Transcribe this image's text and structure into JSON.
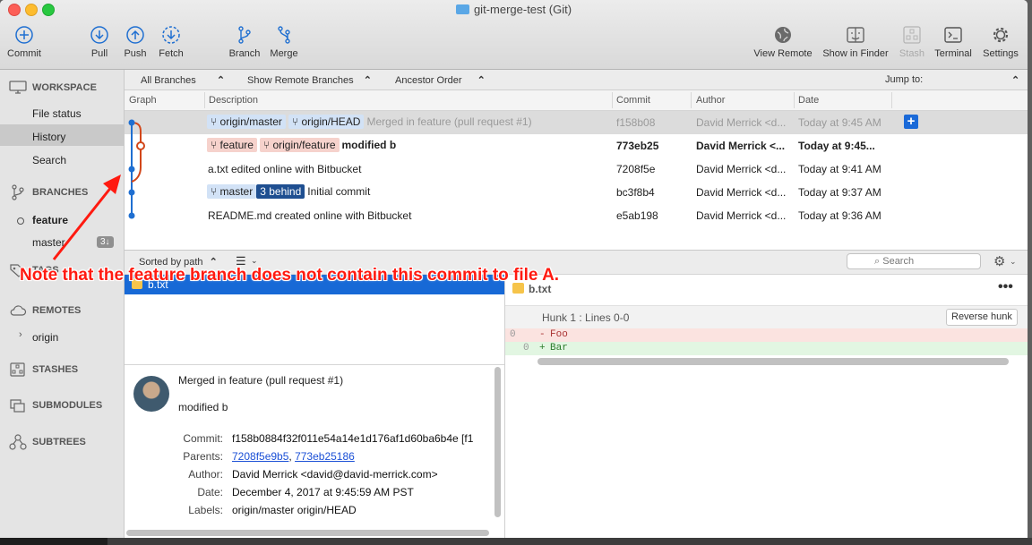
{
  "window": {
    "title": "git-merge-test (Git)"
  },
  "toolbar": {
    "commit": "Commit",
    "pull": "Pull",
    "push": "Push",
    "fetch": "Fetch",
    "branch": "Branch",
    "merge": "Merge",
    "view_remote": "View Remote",
    "show_in_finder": "Show in Finder",
    "stash": "Stash",
    "terminal": "Terminal",
    "settings": "Settings"
  },
  "sidebar": {
    "workspace": "WORKSPACE",
    "file_status": "File status",
    "history": "History",
    "search": "Search",
    "branches": "BRANCHES",
    "feature": "feature",
    "master": "master",
    "master_badge": "3↓",
    "tags": "TAGS",
    "remotes": "REMOTES",
    "origin": "origin",
    "stashes": "STASHES",
    "submodules": "SUBMODULES",
    "subtrees": "SUBTREES"
  },
  "filters": {
    "all_branches": "All Branches",
    "show_remote": "Show Remote Branches",
    "ancestor_order": "Ancestor Order",
    "jump_to": "Jump to:"
  },
  "columns": {
    "graph": "Graph",
    "description": "Description",
    "commit": "Commit",
    "author": "Author",
    "date": "Date"
  },
  "commits": [
    {
      "tags": [
        "origin/master",
        "origin/HEAD"
      ],
      "message": "Merged in feature (pull request #1)",
      "hash": "f158b08",
      "author": "David Merrick <d...",
      "date": "Today at 9:45 AM"
    },
    {
      "tags": [
        "feature",
        "origin/feature"
      ],
      "message": "modified b",
      "hash": "773eb25",
      "author": "David Merrick <...",
      "date": "Today at 9:45..."
    },
    {
      "tags": [],
      "message": "a.txt edited online with Bitbucket",
      "hash": "7208f5e",
      "author": "David Merrick <d...",
      "date": "Today at 9:41 AM"
    },
    {
      "tags": [
        "master",
        "3 behind"
      ],
      "message": "Initial commit",
      "hash": "bc3f8b4",
      "author": "David Merrick <d...",
      "date": "Today at 9:37 AM"
    },
    {
      "tags": [],
      "message": "README.md created online with Bitbucket",
      "hash": "e5ab198",
      "author": "David Merrick <d...",
      "date": "Today at 9:36 AM"
    }
  ],
  "files": {
    "sort": "Sorted by path",
    "search_placeholder": "Search",
    "selected_file": "b.txt"
  },
  "diff": {
    "file": "b.txt",
    "hunk": "Hunk 1 : Lines 0-0",
    "reverse": "Reverse hunk",
    "lines": [
      {
        "old": "0",
        "new": "",
        "sign": "-",
        "text": "Foo"
      },
      {
        "old": "",
        "new": "0",
        "sign": "+",
        "text": "Bar"
      }
    ]
  },
  "details": {
    "message_line1": "Merged in feature (pull request #1)",
    "message_line2": "modified b",
    "commit_label": "Commit:",
    "commit": "f158b0884f32f011e54a14e1d176af1d60ba6b4e [f1",
    "parents_label": "Parents:",
    "parent1": "7208f5e9b5",
    "parent2": "773eb25186",
    "author_label": "Author:",
    "author": "David Merrick <david@david-merrick.com>",
    "date_label": "Date:",
    "date": "December 4, 2017 at 9:45:59 AM PST",
    "labels_label": "Labels:",
    "labels": "origin/master origin/HEAD"
  },
  "annotation": "Note that the feature branch does not contain this commit to file A.",
  "colors": {
    "accent": "#1769d6",
    "annotation": "#ff1a10",
    "graph_blue": "#1f6fd1",
    "graph_orange": "#d2471a"
  }
}
